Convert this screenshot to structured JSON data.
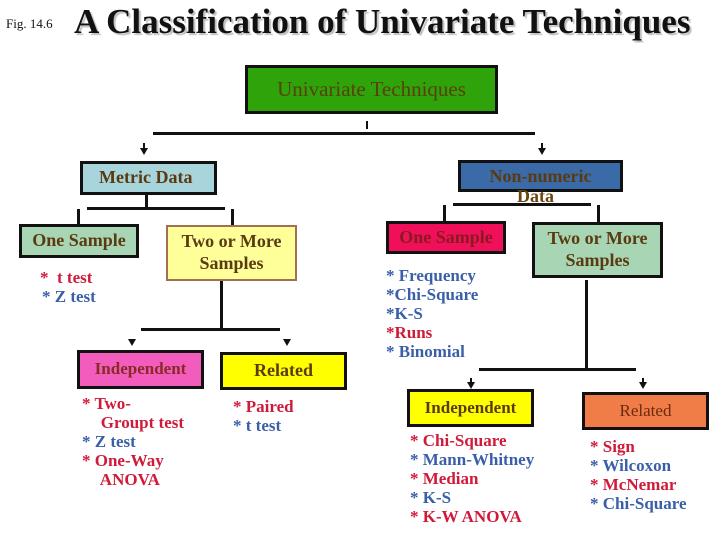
{
  "header": {
    "fig_label": "Fig. 14.6",
    "title": "A Classification of Univariate Techniques"
  },
  "colors": {
    "root_box": "#2ea40a",
    "metric_box": "#a8d4dc",
    "nonnumeric_box": "#3a6aa8",
    "one_sample_metric_box": "#a8d6b4",
    "two_samples_metric_box": "#ffff99",
    "independent_metric_box": "#f25cbc",
    "related_metric_box": "#ffff00",
    "one_sample_nonmetric_box": "#f0105a",
    "two_samples_nonmetric_box": "#a8d6b4",
    "independent_nonmetric_box": "#ffff00",
    "related_nonmetric_box": "#f07c48",
    "list_red": "#d01a3a",
    "list_blue": "#3a5fa8"
  },
  "root": {
    "label": "Univariate Techniques"
  },
  "metric": {
    "label": "Metric Data",
    "one_sample": {
      "label": "One Sample",
      "tests": [
        {
          "text": "*  t test",
          "color": "red"
        },
        {
          "text": "* Z test",
          "color": "blue"
        }
      ]
    },
    "two_samples": {
      "label_line1": "Two or More",
      "label_line2": "Samples",
      "independent": {
        "label": "Independent",
        "tests": [
          {
            "text": "* Two-",
            "color": "red"
          },
          {
            "text": "   Groupt test",
            "color": "red"
          },
          {
            "text": "* Z test",
            "color": "blue"
          },
          {
            "text": "* One-Way",
            "color": "red"
          },
          {
            "text": "   ANOVA",
            "color": "red"
          }
        ]
      },
      "related": {
        "label": "Related",
        "tests": [
          {
            "text": "* Paired",
            "color": "red"
          },
          {
            "text": "* t test",
            "color": "blue"
          }
        ]
      }
    }
  },
  "nonmetric": {
    "label_line1": "Non-numeric",
    "label_line2": "Data",
    "one_sample": {
      "label": "One Sample",
      "tests": [
        {
          "text": "* Frequency",
          "color": "blue"
        },
        {
          "text": "*Chi-Square",
          "color": "blue"
        },
        {
          "text": "*K-S",
          "color": "blue"
        },
        {
          "text": "*Runs",
          "color": "red"
        },
        {
          "text": "* Binomial",
          "color": "blue"
        }
      ]
    },
    "two_samples": {
      "label_line1": "Two or More",
      "label_line2": "Samples",
      "independent": {
        "label": "Independent",
        "tests": [
          {
            "text": "* Chi-Square",
            "color": "red"
          },
          {
            "text": "* Mann-Whitney",
            "color": "blue"
          },
          {
            "text": "* Median",
            "color": "red"
          },
          {
            "text": "* K-S",
            "color": "blue"
          },
          {
            "text": "* K-W ANOVA",
            "color": "red"
          }
        ]
      },
      "related": {
        "label": "Related",
        "tests": [
          {
            "text": "* Sign",
            "color": "red"
          },
          {
            "text": "* Wilcoxon",
            "color": "blue"
          },
          {
            "text": "* McNemar",
            "color": "red"
          },
          {
            "text": "* Chi-Square",
            "color": "blue"
          }
        ]
      }
    }
  }
}
